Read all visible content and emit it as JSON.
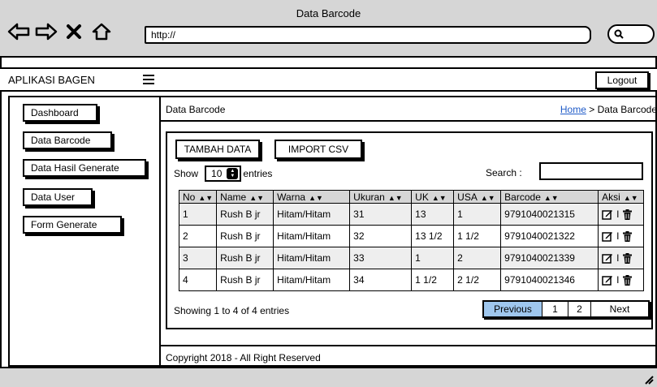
{
  "browser": {
    "title": "Data Barcode",
    "url": "http://",
    "icons": [
      "back-arrow-icon",
      "forward-arrow-icon",
      "close-icon",
      "home-icon",
      "search-icon"
    ]
  },
  "header": {
    "app_name": "APLIKASI BAGEN",
    "logout_label": "Logout"
  },
  "sidebar": {
    "items": [
      {
        "label": "Dashboard"
      },
      {
        "label": "Data Barcode"
      },
      {
        "label": "Data Hasil Generate"
      },
      {
        "label": "Data User"
      },
      {
        "label": "Form Generate"
      }
    ]
  },
  "content": {
    "title": "Data Barcode",
    "breadcrumb": {
      "home": "Home",
      "separator": ">",
      "current": "Data Barcode"
    },
    "buttons": {
      "add": "TAMBAH DATA",
      "import": "IMPORT CSV"
    },
    "show_label": "Show",
    "entries_value": "10",
    "entries_label": "entries",
    "search_label": "Search :",
    "search_value": ""
  },
  "table": {
    "headers": [
      "No",
      "Name",
      "Warna",
      "Ukuran",
      "UK",
      "USA",
      "Barcode",
      "Aksi"
    ],
    "rows": [
      [
        "1",
        "Rush B jr",
        "Hitam/Hitam",
        "31",
        "13",
        "1",
        "9791040021315"
      ],
      [
        "2",
        "Rush B jr",
        "Hitam/Hitam",
        "32",
        "13 1/2",
        "1 1/2",
        "9791040021322"
      ],
      [
        "3",
        "Rush B jr",
        "Hitam/Hitam",
        "33",
        "1",
        "2",
        "9791040021339"
      ],
      [
        "4",
        "Rush B jr",
        "Hitam/Hitam",
        "34",
        "1 1/2",
        "2 1/2",
        "9791040021346"
      ]
    ],
    "action_separator": "I"
  },
  "pagination": {
    "info": "Showing 1 to 4 of 4 entries",
    "previous": "Previous",
    "pages": [
      "1",
      "2"
    ],
    "next": "Next"
  },
  "footer": {
    "copyright": "Copyright 2018 - All Right Reserved"
  }
}
